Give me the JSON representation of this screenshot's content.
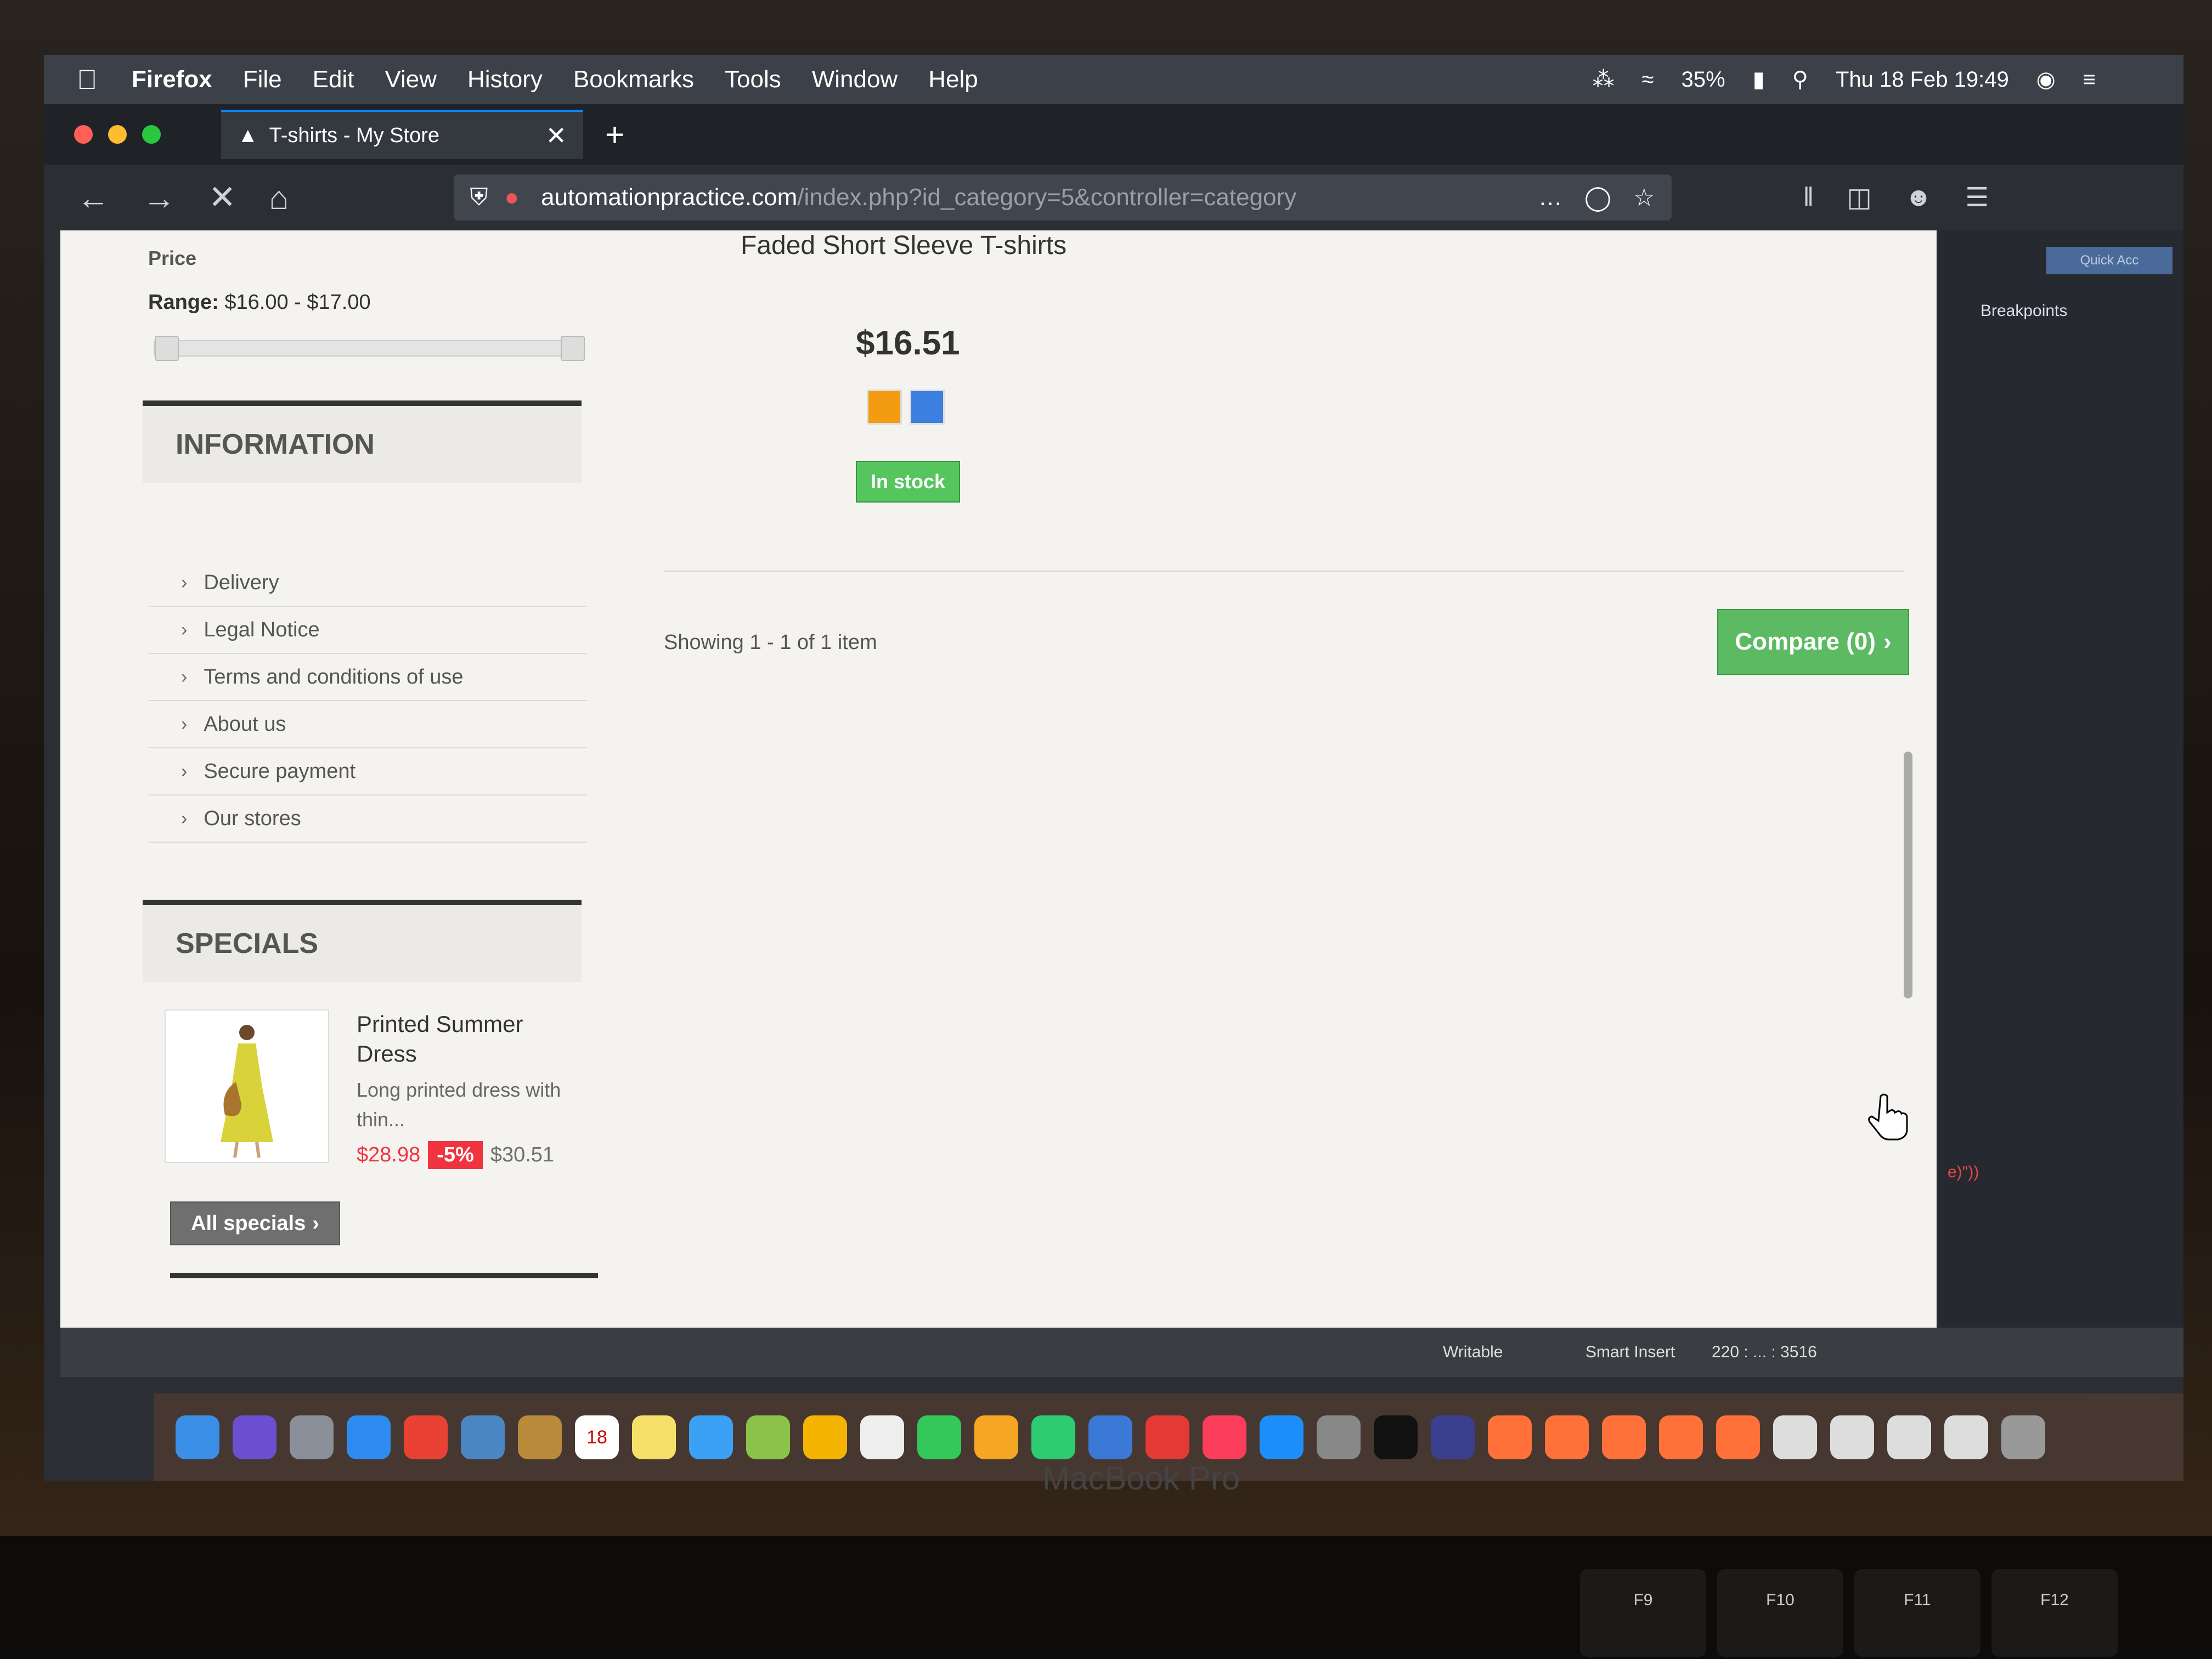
{
  "menubar": {
    "app": "Firefox",
    "items": [
      "File",
      "Edit",
      "View",
      "History",
      "Bookmarks",
      "Tools",
      "Window",
      "Help"
    ],
    "battery": "35%",
    "clock": "Thu 18 Feb 19:49"
  },
  "browser": {
    "tab_title": "T-shirts - My Store",
    "url_host": "automationpractice.com",
    "url_path": "/index.php?id_category=5&controller=category"
  },
  "sidebar": {
    "price_label": "Price",
    "range_label": "Range:",
    "range_value": "$16.00 - $17.00",
    "range_handles_fraction": [
      0.0,
      1.0
    ],
    "information_title": "INFORMATION",
    "information_items": [
      "Delivery",
      "Legal Notice",
      "Terms and conditions of use",
      "About us",
      "Secure payment",
      "Our stores"
    ],
    "specials_title": "SPECIALS",
    "special": {
      "name": "Printed Summer Dress",
      "description": "Long printed dress with thin...",
      "price": "$28.98",
      "discount": "-5%",
      "old_price": "$30.51"
    },
    "all_specials": "All specials"
  },
  "product": {
    "name": "Faded Short Sleeve T-shirts",
    "price": "$16.51",
    "swatch_colors": [
      "#f39c11",
      "#3b7fe0"
    ],
    "availability": "In stock"
  },
  "listing": {
    "showing": "Showing 1 - 1 of 1 item",
    "compare": "Compare (0)"
  },
  "devtools": {
    "breakpoints": "Breakpoints",
    "quick": "Quick Acc",
    "code": "e)\"))"
  },
  "editor_status": {
    "writable": "Writable",
    "insert": "Smart Insert",
    "position": "220 : ... : 3516"
  },
  "dock": {
    "calendar_day": "18"
  },
  "hardware": {
    "brand": "MacBook Pro",
    "keys": [
      "F9",
      "F10",
      "F11",
      "F12"
    ]
  },
  "colors": {
    "accent_green": "#5cba62",
    "sale_red": "#f13340",
    "stock_green": "#55c65e"
  }
}
